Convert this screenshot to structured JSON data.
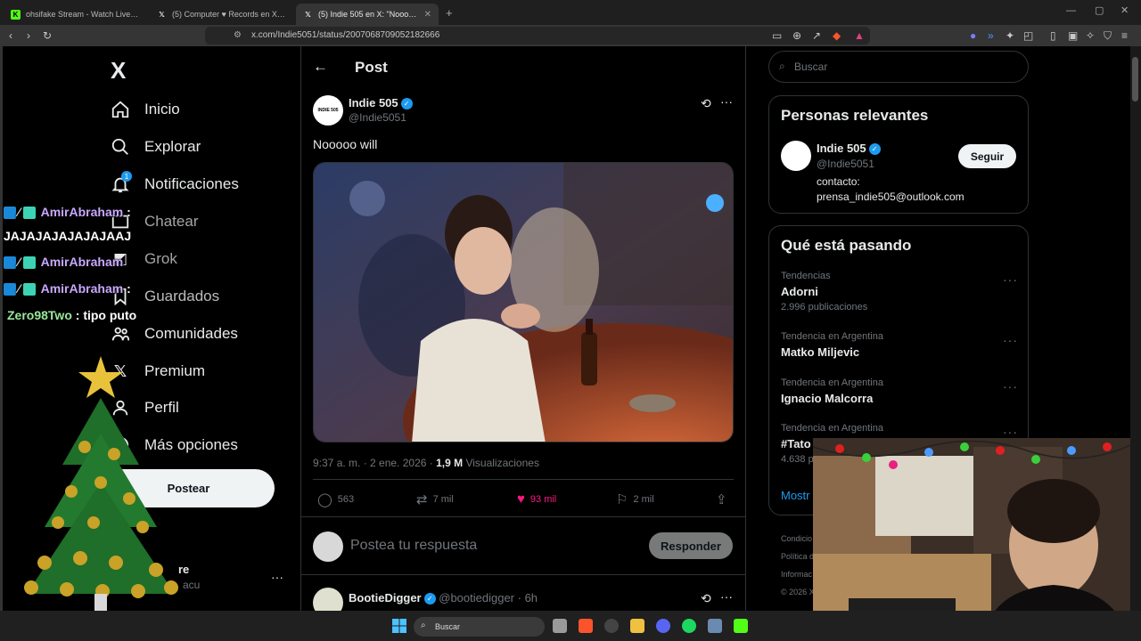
{
  "browser": {
    "tabs": [
      {
        "title": "ohsifake Stream - Watch Live on",
        "favicon": "kick-icon"
      },
      {
        "title": "(5) Computer ♥ Records en X: \"PlayS",
        "favicon": "x-icon"
      },
      {
        "title": "(5) Indie 505 en X: \"Nooooo will",
        "favicon": "x-icon",
        "active": true
      }
    ],
    "new_tab": "+",
    "url": "x.com/Indie5051/status/2007068709052182666"
  },
  "sidebar": {
    "logo": "X",
    "items": [
      {
        "label": "Inicio",
        "icon": "home-icon"
      },
      {
        "label": "Explorar",
        "icon": "search-icon"
      },
      {
        "label": "Notificaciones",
        "icon": "bell-icon",
        "badge": "1"
      },
      {
        "label": "Chatear",
        "icon": "mail-icon"
      },
      {
        "label": "Grok",
        "icon": "grok-icon"
      },
      {
        "label": "Guardados",
        "icon": "bookmark-icon"
      },
      {
        "label": "Comunidades",
        "icon": "people-icon"
      },
      {
        "label": "Premium",
        "icon": "x-icon"
      },
      {
        "label": "Perfil",
        "icon": "person-icon"
      },
      {
        "label": "Más opciones",
        "icon": "more-circle-icon"
      }
    ],
    "post_button": "Postear",
    "account_name": "re",
    "account_handle": "acu",
    "account_more": "···"
  },
  "header": {
    "title": "Post"
  },
  "post": {
    "author_name": "Indie 505",
    "author_handle": "@Indie5051",
    "avatar_text": "INDIE 505",
    "text": "Nooooo will",
    "timestamp": "9:37 a. m. · 2 ene. 2026 ·",
    "views_count": "1,9 M",
    "views_label": "Visualizaciones",
    "replies": "563",
    "reposts": "7 mil",
    "likes": "93 mil",
    "bookmarks": "2 mil"
  },
  "reply_box": {
    "placeholder": "Postea tu respuesta",
    "button": "Responder"
  },
  "next_reply": {
    "author_name": "BootieDigger",
    "author_handle": "@bootiedigger",
    "time": "· 6h"
  },
  "right": {
    "search_placeholder": "Buscar",
    "relevant_title": "Personas relevantes",
    "relevant_person": {
      "name": "Indie 505",
      "handle": "@Indie5051",
      "bio_1": "contacto:",
      "bio_2": "prensa_indie505@outlook.com",
      "follow": "Seguir"
    },
    "trends_title": "Qué está pasando",
    "trends": [
      {
        "category": "Tendencias",
        "name": "Adorni",
        "posts": "2.996 publicaciones"
      },
      {
        "category": "Tendencia en Argentina",
        "name": "Matko Miljevic",
        "posts": ""
      },
      {
        "category": "Tendencia en Argentina",
        "name": "Ignacio Malcorra",
        "posts": ""
      },
      {
        "category": "Tendencia en Argentina",
        "name": "#Tato",
        "posts": "4.638 p"
      }
    ],
    "show_more": "Mostr",
    "footer_lines": [
      "Condicio",
      "Política d",
      "Informac",
      "© 2026 X"
    ]
  },
  "chat_overlay": [
    {
      "user": "AmirAbraham",
      "message": ""
    },
    {
      "user": "",
      "message": "JAJAJAJAJAJAJAAJ"
    },
    {
      "user": "AmirAbraham",
      "message": ""
    },
    {
      "user": "AmirAbraham",
      "message": ""
    },
    {
      "user": "Zero98Two",
      "message": "tipo puto"
    }
  ],
  "taskbar": {
    "search": "Buscar"
  },
  "colors": {
    "accent": "#1d9bf0",
    "like": "#f91880",
    "bg": "#000000",
    "border": "#2f3336"
  }
}
